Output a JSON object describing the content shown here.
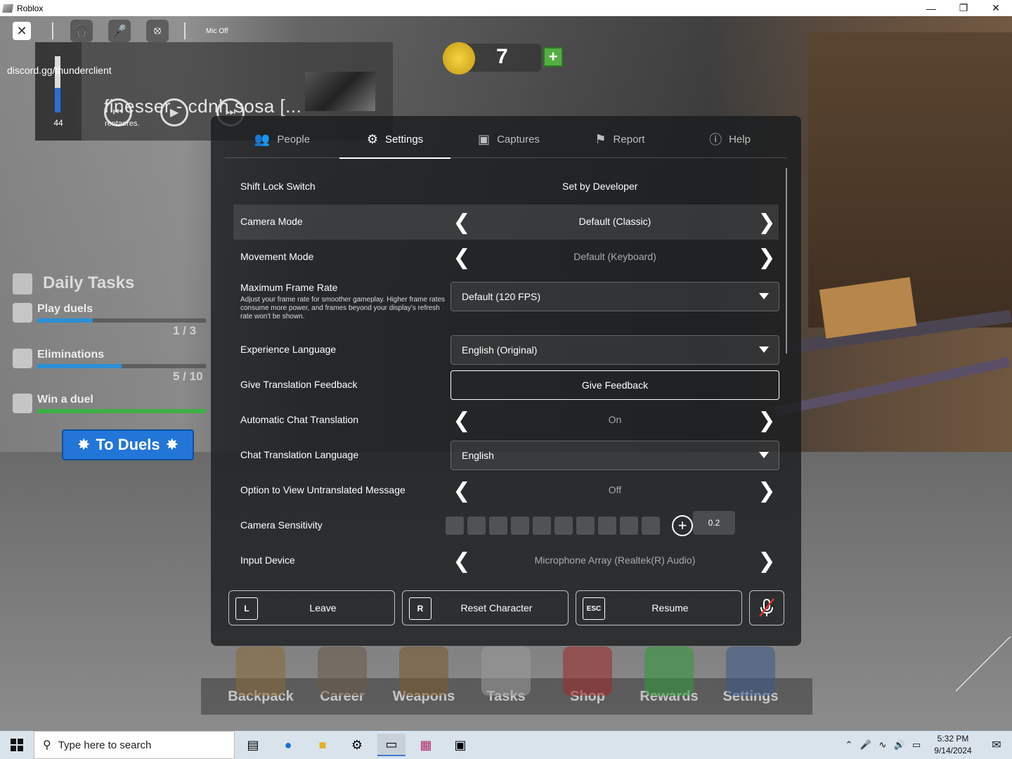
{
  "window": {
    "title": "Roblox"
  },
  "topbar": {
    "mic_label": "Mic Off"
  },
  "music": {
    "volume": "44",
    "volume_fraction": 0.44,
    "discord": "discord.gg/thunderclient",
    "song": "finesser - cdnh sosa [...",
    "artist": "rentaores."
  },
  "coins": {
    "value": "7"
  },
  "daily_tasks": {
    "title": "Daily Tasks",
    "tasks": [
      {
        "name": "Play duels",
        "count": "1 / 3",
        "progress": 0.33,
        "color": "#2b8fd6"
      },
      {
        "name": "Eliminations",
        "count": "5 / 10",
        "progress": 0.5,
        "color": "#2b8fd6"
      },
      {
        "name": "Win a duel",
        "count": "",
        "progress": 1.0,
        "color": "#3bb143"
      }
    ],
    "button": "To Duels"
  },
  "tabs": [
    {
      "label": "People",
      "icon": "people-icon",
      "active": false
    },
    {
      "label": "Settings",
      "icon": "gear-icon",
      "active": true
    },
    {
      "label": "Captures",
      "icon": "camera-icon",
      "active": false
    },
    {
      "label": "Report",
      "icon": "flag-icon",
      "active": false
    },
    {
      "label": "Help",
      "icon": "help-icon",
      "active": false
    }
  ],
  "settings": {
    "shift_lock": {
      "label": "Shift Lock Switch",
      "value": "Set by Developer"
    },
    "camera_mode": {
      "label": "Camera Mode",
      "value": "Default (Classic)"
    },
    "movement_mode": {
      "label": "Movement Mode",
      "value": "Default (Keyboard)"
    },
    "max_frame_rate": {
      "label": "Maximum Frame Rate",
      "description": "Adjust your frame rate for smoother gameplay. Higher frame rates consume more power, and frames beyond your display's refresh rate won't be shown.",
      "value": "Default (120 FPS)"
    },
    "experience_language": {
      "label": "Experience Language",
      "value": "English (Original)"
    },
    "translation_feedback": {
      "label": "Give Translation Feedback",
      "button": "Give Feedback"
    },
    "auto_chat_translation": {
      "label": "Automatic Chat Translation",
      "value": "On"
    },
    "chat_translation_language": {
      "label": "Chat Translation Language",
      "value": "English"
    },
    "view_untranslated": {
      "label": "Option to View Untranslated Message",
      "value": "Off"
    },
    "camera_sensitivity": {
      "label": "Camera Sensitivity",
      "value": "0.2"
    },
    "input_device": {
      "label": "Input Device",
      "value": "Microphone Array (Realtek(R) Audio)"
    }
  },
  "actions": {
    "leave": {
      "key": "L",
      "label": "Leave"
    },
    "reset": {
      "key": "R",
      "label": "Reset Character"
    },
    "resume": {
      "key": "ESC",
      "label": "Resume"
    }
  },
  "hotbar": [
    "Backpack",
    "Career",
    "Weapons",
    "Tasks",
    "Shop",
    "Rewards",
    "Settings"
  ],
  "taskbar": {
    "search_placeholder": "Type here to search",
    "time": "5:32 PM",
    "date": "9/14/2024"
  }
}
